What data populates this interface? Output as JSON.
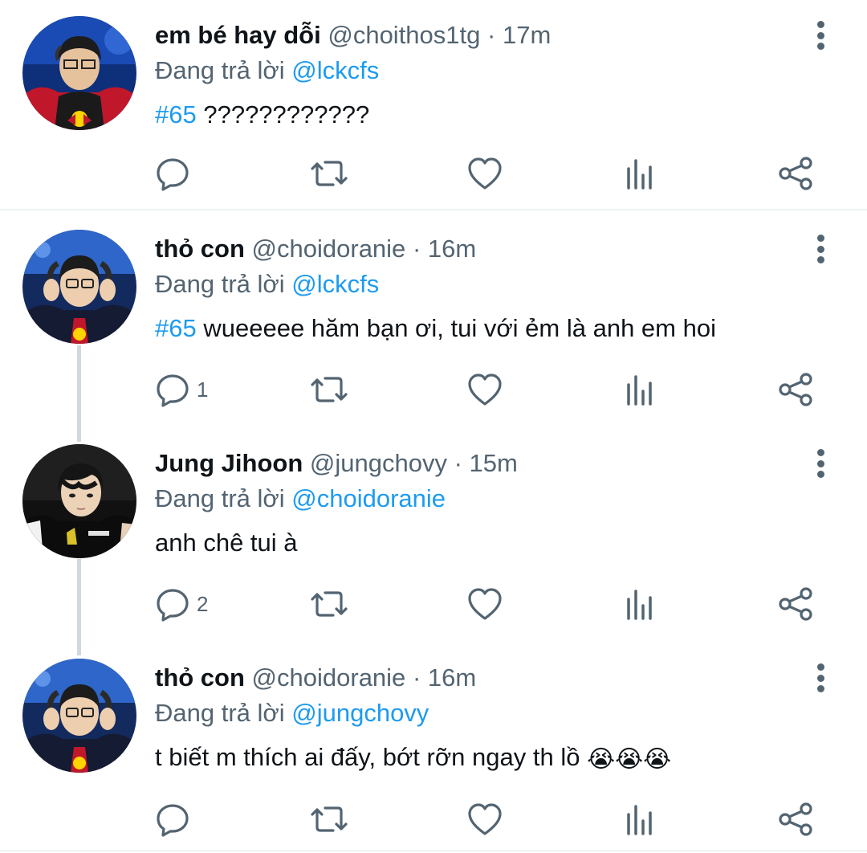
{
  "tweets": [
    {
      "name": "em bé hay dỗi",
      "handle": "@choithos1tg",
      "sep": "·",
      "time": "17m",
      "replying_prefix": "Đang trả lời",
      "replying_to": "@lckcfs",
      "hashtag": "#65",
      "text": " ????????????",
      "reply_count": "",
      "avatar_icon": "avatar-em-be-hay-doi"
    },
    {
      "name": "thỏ con",
      "handle": "@choidoranie",
      "sep": "·",
      "time": "16m",
      "replying_prefix": "Đang trả lời",
      "replying_to": "@lckcfs",
      "hashtag": "#65",
      "text": " wueeeee hăm bạn ơi, tui với ẻm là anh em hoi",
      "reply_count": "1",
      "avatar_icon": "avatar-tho-con"
    },
    {
      "name": "Jung Jihoon",
      "handle": "@jungchovy",
      "sep": "·",
      "time": "15m",
      "replying_prefix": "Đang trả lời",
      "replying_to": "@choidoranie",
      "hashtag": "",
      "text": "anh chê tui à",
      "reply_count": "2",
      "avatar_icon": "avatar-jung-jihoon"
    },
    {
      "name": "thỏ con",
      "handle": "@choidoranie",
      "sep": "·",
      "time": "16m",
      "replying_prefix": "Đang trả lời",
      "replying_to": "@jungchovy",
      "hashtag": "",
      "text": "t biết m thích ai đấy, bớt rỡn ngay th lồ ",
      "emoji": "😭😭😭",
      "reply_count": "",
      "avatar_icon": "avatar-tho-con"
    }
  ],
  "colors": {
    "text": "#0f1419",
    "secondary": "#536471",
    "accent": "#1d9bf0",
    "divider": "#eff3f4",
    "thread_line": "#cfd9de"
  },
  "action_icons": [
    "reply-icon",
    "retweet-icon",
    "like-icon",
    "analytics-icon",
    "share-icon"
  ]
}
